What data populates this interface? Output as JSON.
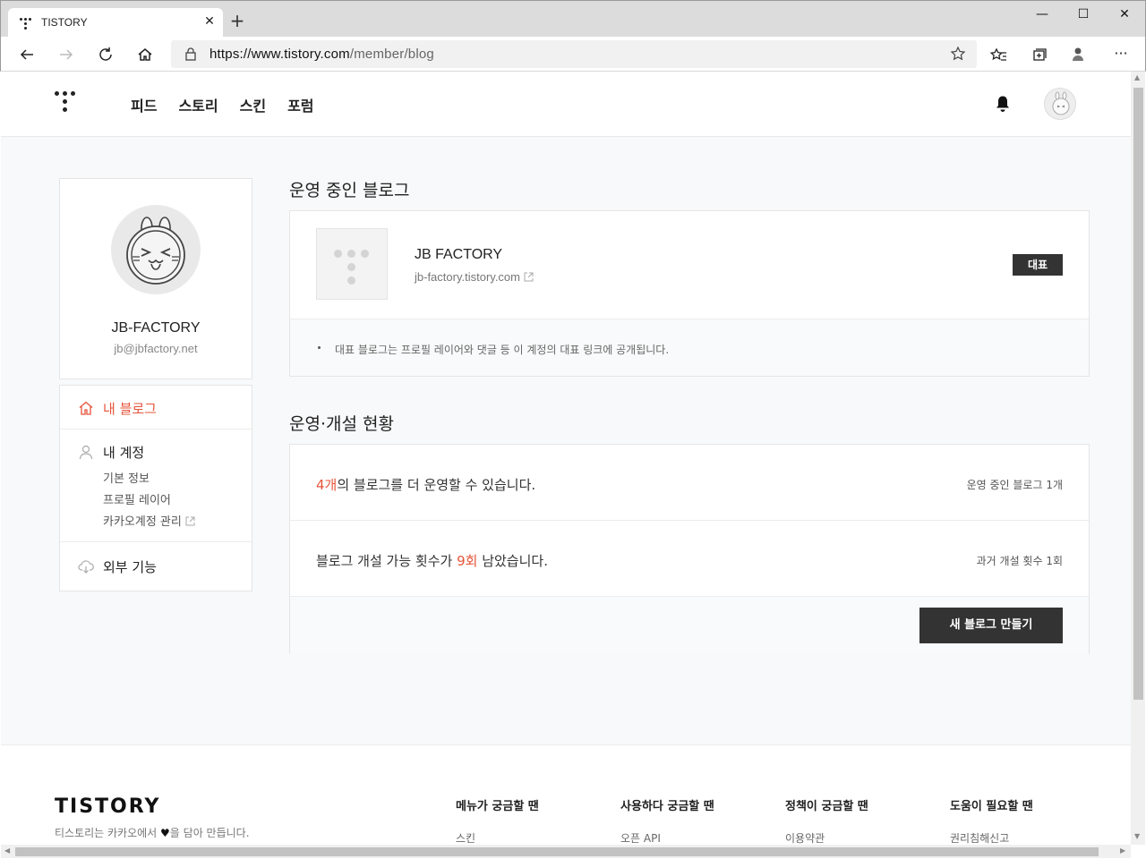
{
  "browser": {
    "tab_title": "TISTORY",
    "url_host": "https://www.tistory.com",
    "url_path": "/member/blog"
  },
  "site": {
    "nav": [
      "피드",
      "스토리",
      "스킨",
      "포럼"
    ]
  },
  "profile": {
    "name": "JB-FACTORY",
    "email": "jb@jbfactory.net"
  },
  "sidebar": {
    "my_blog": "내 블로그",
    "my_account": "내 계정",
    "account_items": [
      "기본 정보",
      "프로필 레이어",
      "카카오계정 관리"
    ],
    "external": "외부 기능"
  },
  "main": {
    "active_title": "운영 중인 블로그",
    "blog": {
      "name": "JB FACTORY",
      "url": "jb-factory.tistory.com",
      "badge": "대표"
    },
    "notice": "대표 블로그는 프로필 레이어와 댓글 등 이 계정의 대표 링크에 공개됩니다.",
    "status_title": "운영·개설 현황",
    "row1": {
      "count": "4개",
      "text": "의 블로그를 더 운영할 수 있습니다.",
      "side": "운영 중인 블로그 1개"
    },
    "row2": {
      "prefix": "블로그 개설 가능 횟수가 ",
      "count": "9회",
      "suffix": " 남았습니다.",
      "side": "과거 개설 횟수 1회"
    },
    "new_blog_button": "새 블로그 만들기"
  },
  "footer": {
    "logo": "TISTORY",
    "tagline_pre": "티스토리는 카카오에서 ",
    "tagline_post": "을 담아 만듭니다.",
    "columns": [
      {
        "title": "메뉴가 궁금할 땐",
        "link": "스킨"
      },
      {
        "title": "사용하다 궁금할 땐",
        "link": "오픈 API"
      },
      {
        "title": "정책이 궁금할 땐",
        "link": "이용약관"
      },
      {
        "title": "도움이 필요할 땐",
        "link": "권리침해신고"
      }
    ]
  },
  "colors": {
    "accent": "#e6553a",
    "dark": "#333333"
  }
}
